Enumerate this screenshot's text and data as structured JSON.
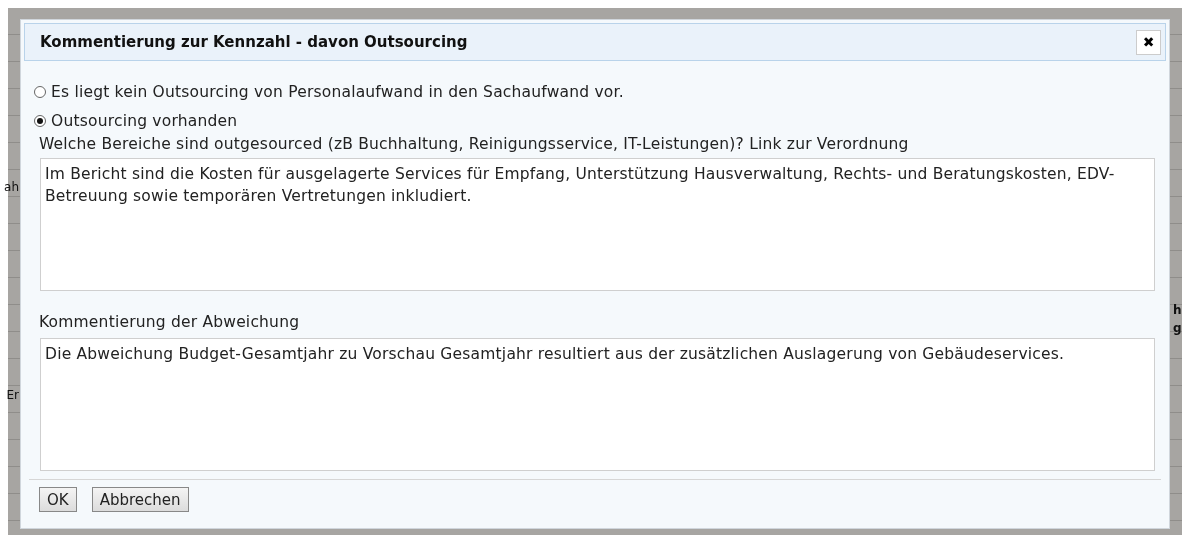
{
  "background": {
    "fragments_left": [
      "ah",
      "Er"
    ],
    "fragments_right": [
      "h",
      "g"
    ]
  },
  "dialog": {
    "title": "Kommentierung zur Kennzahl - davon Outsourcing",
    "close_icon": "✖",
    "options": [
      {
        "label": "Es liegt kein Outsourcing von Personalaufwand in den Sachaufwand vor.",
        "selected": false
      },
      {
        "label": "Outsourcing vorhanden",
        "selected": true
      }
    ],
    "areas_question": "Welche Bereiche sind outgesourced (zB Buchhaltung, Reinigungsservice, IT-Leistungen)?",
    "areas_link": "Link zur Verordnung",
    "areas_value": "Im Bericht sind die Kosten für ausgelagerte Services für Empfang, Unterstützung Hausverwaltung, Rechts- und Beratungskosten, EDV-Betreuung sowie temporären Vertretungen inkludiert.",
    "deviation_label": "Kommentierung der Abweichung",
    "deviation_value": "Die Abweichung Budget-Gesamtjahr zu Vorschau Gesamtjahr resultiert aus der zusätzlichen Auslagerung von Gebäudeservices.",
    "buttons": [
      "OK",
      "Abbrechen"
    ]
  }
}
